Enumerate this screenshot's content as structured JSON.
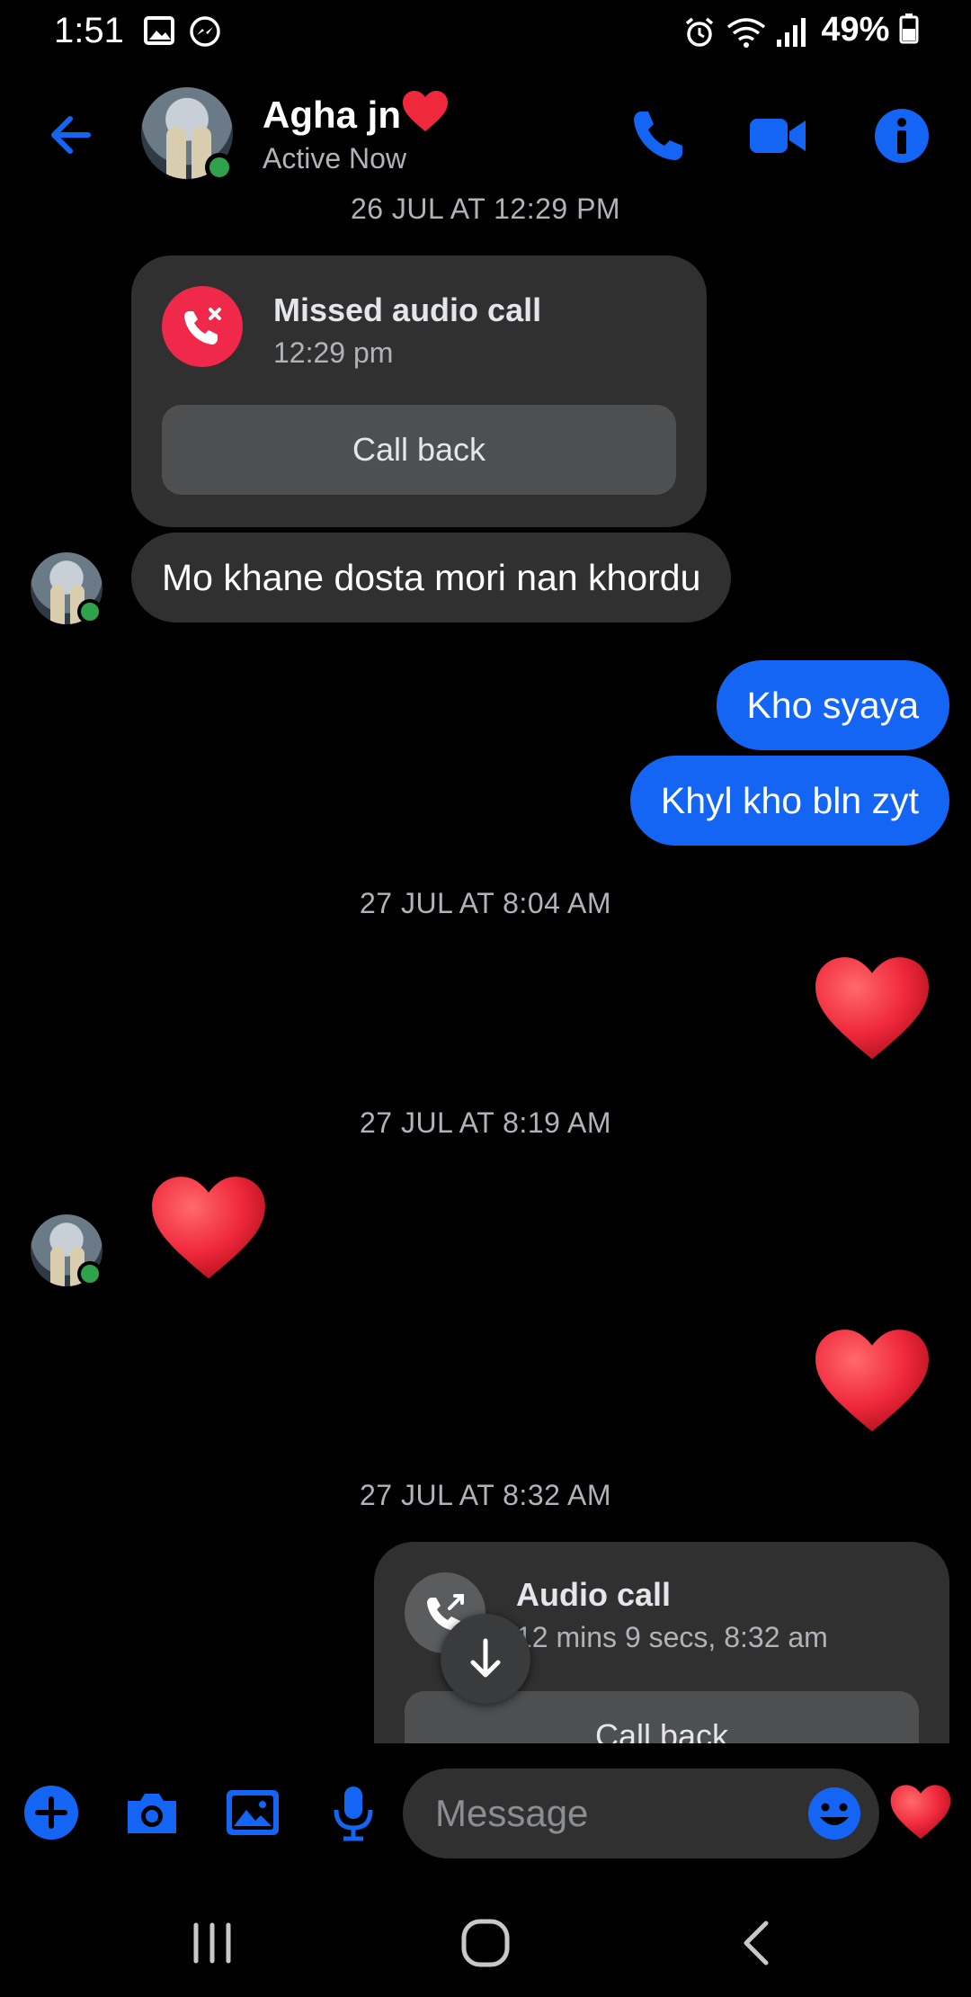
{
  "status_bar": {
    "time": "1:51",
    "battery": "49%"
  },
  "header": {
    "contact_name": "Agha jn",
    "status": "Active Now"
  },
  "messages": {
    "ts1_partial": "26 JUL AT 12:29 PM",
    "missed_call": {
      "title": "Missed audio call",
      "time": "12:29 pm",
      "callback": "Call back"
    },
    "in_text_1": "Mo khane dosta mori nan khordu",
    "out_text_1": "Kho syaya",
    "out_text_2": "Khyl kho bln zyt",
    "ts2": "27 JUL AT 8:04 AM",
    "ts3": "27 JUL AT 8:19 AM",
    "ts4": "27 JUL AT 8:32 AM",
    "audio_call": {
      "title": "Audio call",
      "detail": "12 mins 9 secs, 8:32 am",
      "callback": "Call back"
    }
  },
  "composer": {
    "placeholder": "Message"
  },
  "colors": {
    "accent": "#1465f4",
    "incoming_bubble": "#303030",
    "missed_call_red": "#f02849",
    "online_green": "#31a24c",
    "heart_red": "#f0283c"
  },
  "icons": {
    "header": [
      "back-arrow-icon",
      "phone-icon",
      "video-camera-icon",
      "info-icon"
    ],
    "composer": [
      "plus-icon",
      "camera-icon",
      "gallery-icon",
      "microphone-icon",
      "emoji-icon",
      "heart-icon"
    ],
    "navbar": [
      "recent-apps-icon",
      "home-icon",
      "back-icon"
    ]
  }
}
